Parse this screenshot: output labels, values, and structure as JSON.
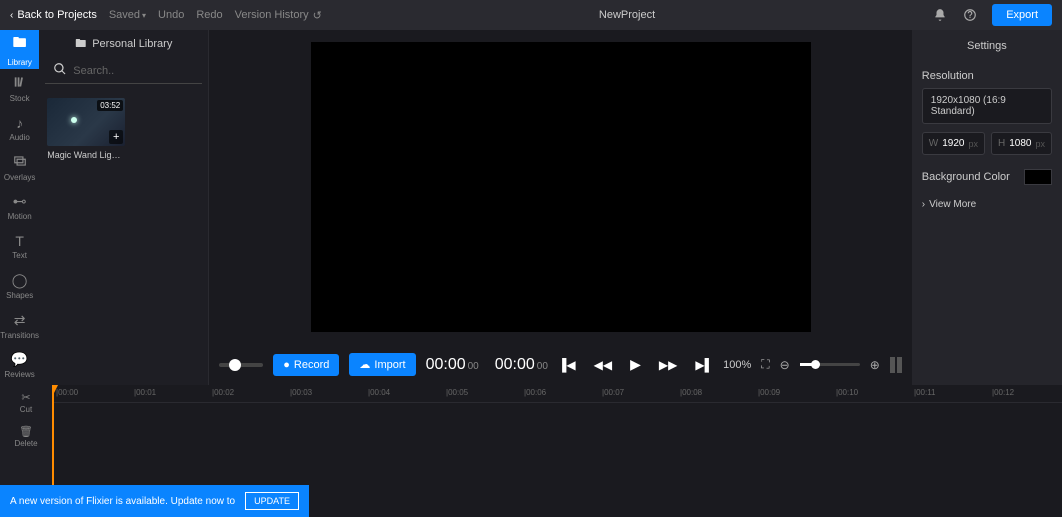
{
  "header": {
    "back": "Back to Projects",
    "saved": "Saved",
    "undo": "Undo",
    "redo": "Redo",
    "version_history": "Version History",
    "project_name": "NewProject",
    "export": "Export"
  },
  "side_nav": [
    {
      "id": "library",
      "label": "Library"
    },
    {
      "id": "stock",
      "label": "Stock"
    },
    {
      "id": "audio",
      "label": "Audio"
    },
    {
      "id": "overlays",
      "label": "Overlays"
    },
    {
      "id": "motion",
      "label": "Motion"
    },
    {
      "id": "text",
      "label": "Text"
    },
    {
      "id": "shapes",
      "label": "Shapes"
    },
    {
      "id": "transitions",
      "label": "Transitions"
    },
    {
      "id": "reviews",
      "label": "Reviews"
    }
  ],
  "library": {
    "title": "Personal Library",
    "search_placeholder": "Search..",
    "clips": [
      {
        "duration": "03:52",
        "name": "Magic Wand Light..."
      }
    ]
  },
  "controls": {
    "record": "Record",
    "import": "Import",
    "time_current_big": "00:00",
    "time_current_small": "00",
    "time_total_big": "00:00",
    "time_total_small": "00",
    "zoom_pct": "100%"
  },
  "settings": {
    "title": "Settings",
    "resolution_label": "Resolution",
    "resolution_value": "1920x1080 (16:9 Standard)",
    "w_label": "W",
    "w_value": "1920",
    "w_unit": "px",
    "h_label": "H",
    "h_value": "1080",
    "h_unit": "px",
    "bg_label": "Background Color",
    "bg_color": "#000000",
    "view_more": "View More"
  },
  "timeline": {
    "tools": [
      {
        "id": "cut",
        "label": "Cut"
      },
      {
        "id": "delete",
        "label": "Delete"
      }
    ],
    "ruler": [
      "|00:00",
      "|00:01",
      "|00:02",
      "|00:03",
      "|00:04",
      "|00:05",
      "|00:06",
      "|00:07",
      "|00:08",
      "|00:09",
      "|00:10",
      "|00:11",
      "|00:12"
    ]
  },
  "banner": {
    "text": "A new version of Flixier is available. Update now to",
    "button": "UPDATE"
  }
}
